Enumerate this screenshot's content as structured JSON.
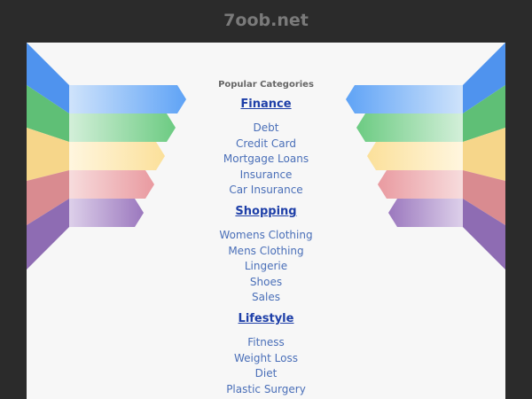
{
  "site": {
    "title": "7oob.net"
  },
  "panel": {
    "heading": "Popular Categories"
  },
  "categories": [
    {
      "title": "Finance",
      "links": [
        "Debt",
        "Credit Card",
        "Mortgage Loans",
        "Insurance",
        "Car Insurance"
      ]
    },
    {
      "title": "Shopping",
      "links": [
        "Womens Clothing",
        "Mens Clothing",
        "Lingerie",
        "Shoes",
        "Sales"
      ]
    },
    {
      "title": "Lifestyle",
      "links": [
        "Fitness",
        "Weight Loss",
        "Diet",
        "Plastic Surgery"
      ]
    }
  ],
  "ribbon_colors": {
    "blue": "#6aaaf5",
    "green": "#7ccf8e",
    "yellow": "#fbe3a3",
    "red": "#eaa2a6",
    "purple": "#a381c2"
  }
}
